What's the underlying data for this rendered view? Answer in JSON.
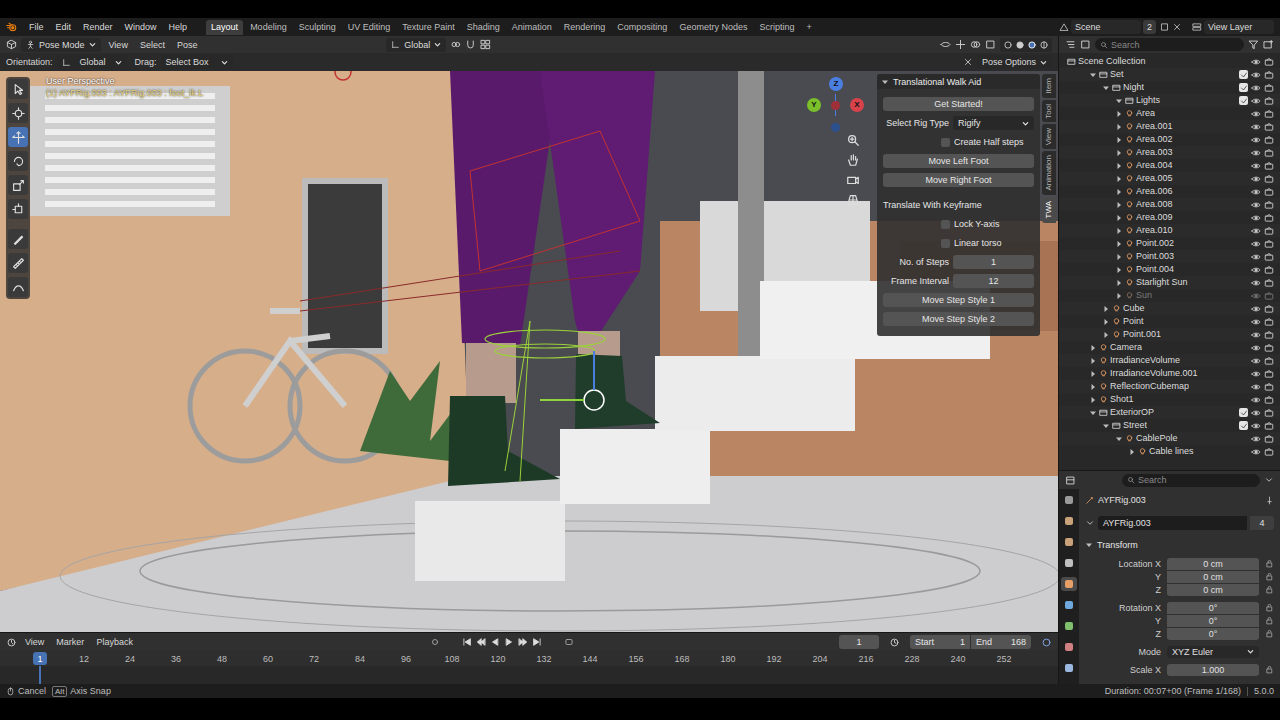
{
  "menu": [
    "File",
    "Edit",
    "Render",
    "Window",
    "Help"
  ],
  "workspaces": [
    {
      "label": "Layout",
      "selected": true
    },
    {
      "label": "Modeling",
      "selected": false
    },
    {
      "label": "Sculpting",
      "selected": false
    },
    {
      "label": "UV Editing",
      "selected": false
    },
    {
      "label": "Texture Paint",
      "selected": false
    },
    {
      "label": "Shading",
      "selected": false
    },
    {
      "label": "Animation",
      "selected": false
    },
    {
      "label": "Rendering",
      "selected": false
    },
    {
      "label": "Compositing",
      "selected": false
    },
    {
      "label": "Geometry Nodes",
      "selected": false
    },
    {
      "label": "Scripting",
      "selected": false
    }
  ],
  "add_workspace": "+",
  "scene": {
    "name": "Scene",
    "count": "2",
    "view_layer": "View Layer"
  },
  "viewport_header": {
    "mode": "Pose Mode",
    "menus": [
      "View",
      "Select",
      "Pose"
    ],
    "transform": "Global"
  },
  "tool_settings": {
    "orientation_label": "Orientation:",
    "orientation": "Global",
    "drag_label": "Drag:",
    "drag": "Select Box",
    "pose_options": "Pose Options"
  },
  "viewport": {
    "view_name": "User Perspective",
    "object_info": "(1) AYFRig.003 : AYFRig.003 : foot_ik.L",
    "gizmo_axes": [
      "X",
      "Y",
      "Z"
    ]
  },
  "toolbar": {
    "tools": [
      {
        "selected": false
      },
      {
        "selected": false
      },
      {
        "selected": true
      },
      {
        "selected": false
      },
      {
        "selected": false
      },
      {
        "selected": false
      },
      {
        "selected": false
      },
      {
        "selected": false
      },
      {
        "selected": false
      }
    ]
  },
  "side_tabs": [
    {
      "label": "Item",
      "selected": false
    },
    {
      "label": "Tool",
      "selected": false
    },
    {
      "label": "View",
      "selected": false
    },
    {
      "label": "Animation",
      "selected": false
    },
    {
      "label": "TWA",
      "selected": true
    }
  ],
  "panel": {
    "title": "Translational Walk Aid",
    "expanded": true,
    "items": [
      {
        "kind": "button",
        "label": "Get Started!"
      },
      {
        "kind": "select",
        "label": "Select Rig Type",
        "value": "Rigify"
      },
      {
        "kind": "checkbox",
        "label": "Create Half steps",
        "checked": false
      },
      {
        "kind": "button",
        "label": "Move Left Foot"
      },
      {
        "kind": "button",
        "label": "Move Right Foot"
      },
      {
        "kind": "heading",
        "label": "Translate With Keyframe"
      },
      {
        "kind": "checkbox",
        "label": "Lock Y-axis",
        "checked": false
      },
      {
        "kind": "checkbox",
        "label": "Linear torso",
        "checked": false
      },
      {
        "kind": "number",
        "label": "No. of Steps",
        "value": "1"
      },
      {
        "kind": "number",
        "label": "Frame Interval",
        "value": "12"
      },
      {
        "kind": "button",
        "label": "Move Step Style 1"
      },
      {
        "kind": "button",
        "label": "Move Step Style 2"
      }
    ]
  },
  "outliner": {
    "search_placeholder": "Search",
    "rows": [
      {
        "label": "Scene Collection",
        "kind": "root",
        "depth": 0,
        "disabled": false
      },
      {
        "label": "Set",
        "kind": "collection",
        "depth": 0,
        "expanded": true,
        "checked": true,
        "disabled": false
      },
      {
        "label": "Night",
        "kind": "collection",
        "depth": 1,
        "expanded": true,
        "checked": true,
        "disabled": false
      },
      {
        "label": "Lights",
        "kind": "collection",
        "depth": 2,
        "expanded": true,
        "checked": true,
        "disabled": false
      },
      {
        "label": "Area",
        "kind": "object",
        "depth": 2,
        "expanded": false,
        "disabled": false
      },
      {
        "label": "Area.001",
        "kind": "object",
        "depth": 2,
        "expanded": false,
        "disabled": false
      },
      {
        "label": "Area.002",
        "kind": "object",
        "depth": 2,
        "expanded": false,
        "disabled": false
      },
      {
        "label": "Area.003",
        "kind": "object",
        "depth": 2,
        "expanded": false,
        "disabled": false
      },
      {
        "label": "Area.004",
        "kind": "object",
        "depth": 2,
        "expanded": false,
        "disabled": false
      },
      {
        "label": "Area.005",
        "kind": "object",
        "depth": 2,
        "expanded": false,
        "disabled": false
      },
      {
        "label": "Area.006",
        "kind": "object",
        "depth": 2,
        "expanded": false,
        "disabled": false
      },
      {
        "label": "Area.008",
        "kind": "object",
        "depth": 2,
        "expanded": false,
        "disabled": false
      },
      {
        "label": "Area.009",
        "kind": "object",
        "depth": 2,
        "expanded": false,
        "disabled": false
      },
      {
        "label": "Area.010",
        "kind": "object",
        "depth": 2,
        "expanded": false,
        "disabled": false
      },
      {
        "label": "Point.002",
        "kind": "object",
        "depth": 2,
        "expanded": false,
        "disabled": false
      },
      {
        "label": "Point.003",
        "kind": "object",
        "depth": 2,
        "expanded": false,
        "disabled": false
      },
      {
        "label": "Point.004",
        "kind": "object",
        "depth": 2,
        "expanded": false,
        "disabled": false
      },
      {
        "label": "Starlight Sun",
        "kind": "object",
        "depth": 2,
        "expanded": false,
        "disabled": false
      },
      {
        "label": "Sun",
        "kind": "object",
        "depth": 2,
        "expanded": false,
        "disabled": true
      },
      {
        "label": "Cube",
        "kind": "object",
        "depth": 1,
        "expanded": false,
        "disabled": false
      },
      {
        "label": "Point",
        "kind": "object",
        "depth": 1,
        "expanded": false,
        "disabled": false
      },
      {
        "label": "Point.001",
        "kind": "object",
        "depth": 1,
        "expanded": false,
        "disabled": false
      },
      {
        "label": "Camera",
        "kind": "object",
        "depth": 0,
        "expanded": false,
        "disabled": false
      },
      {
        "label": "IrradianceVolume",
        "kind": "object",
        "depth": 0,
        "expanded": false,
        "disabled": false
      },
      {
        "label": "IrradianceVolume.001",
        "kind": "object",
        "depth": 0,
        "expanded": false,
        "disabled": false
      },
      {
        "label": "ReflectionCubemap",
        "kind": "object",
        "depth": 0,
        "expanded": false,
        "disabled": false
      },
      {
        "label": "Shot1",
        "kind": "object",
        "depth": 0,
        "expanded": false,
        "disabled": false
      },
      {
        "label": "ExteriorOP",
        "kind": "collection",
        "depth": 0,
        "expanded": true,
        "checked": true,
        "disabled": false
      },
      {
        "label": "Street",
        "kind": "collection",
        "depth": 1,
        "expanded": true,
        "checked": true,
        "disabled": false
      },
      {
        "label": "CablePole",
        "kind": "object",
        "depth": 2,
        "expanded": true,
        "disabled": false
      },
      {
        "label": "Cable lines",
        "kind": "object",
        "depth": 3,
        "expanded": false,
        "disabled": false
      }
    ]
  },
  "properties": {
    "search_placeholder": "Search",
    "tabs": [
      {
        "selected": false
      },
      {
        "selected": false
      },
      {
        "selected": false
      },
      {
        "selected": false
      },
      {
        "selected": true
      },
      {
        "selected": false
      },
      {
        "selected": false
      },
      {
        "selected": false
      },
      {
        "selected": false
      }
    ],
    "object": "AYFRig.003",
    "data_name": "AYFRig.003",
    "users": "4",
    "section": "Transform",
    "section_expanded": true,
    "groups": [
      [
        {
          "label": "Location X",
          "value": "0 cm",
          "kind": "number"
        },
        {
          "label": "Y",
          "value": "0 cm",
          "kind": "number"
        },
        {
          "label": "Z",
          "value": "0 cm",
          "kind": "number"
        }
      ],
      [
        {
          "label": "Rotation X",
          "value": "0°",
          "kind": "number"
        },
        {
          "label": "Y",
          "value": "0°",
          "kind": "number"
        },
        {
          "label": "Z",
          "value": "0°",
          "kind": "number"
        }
      ],
      [
        {
          "label": "Mode",
          "value": "XYZ Euler",
          "kind": "select"
        }
      ],
      [
        {
          "label": "Scale X",
          "value": "1.000",
          "kind": "number"
        }
      ]
    ]
  },
  "timeline": {
    "menus": [
      "View",
      "Marker",
      "Playback"
    ],
    "current_frame": "1",
    "start_label": "Start",
    "start": "1",
    "end_label": "End",
    "end": "168",
    "playhead": "1",
    "ruler": [
      "12",
      "24",
      "36",
      "48",
      "60",
      "72",
      "84",
      "96",
      "108",
      "120",
      "132",
      "144",
      "156",
      "168",
      "180",
      "192",
      "204",
      "216",
      "228",
      "240",
      "252"
    ]
  },
  "status_bar": {
    "hints": [
      {
        "key": "",
        "label": "Cancel"
      },
      {
        "key": "Alt",
        "label": "Axis Snap"
      }
    ],
    "info": "Duration: 00:07+00 (Frame 1/168)",
    "version": "5.0.0"
  }
}
